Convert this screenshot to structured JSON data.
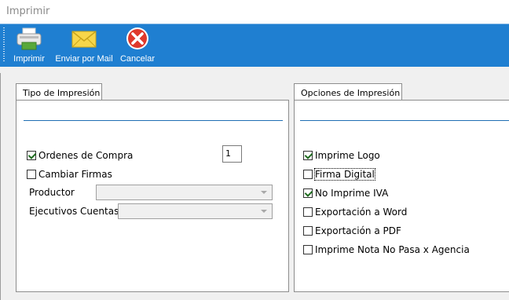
{
  "window": {
    "title": "Imprimir"
  },
  "toolbar": {
    "buttons": [
      {
        "label": "Imprimir",
        "icon": "printer-icon"
      },
      {
        "label": "Enviar por Mail",
        "icon": "envelope-icon"
      },
      {
        "label": "Cancelar",
        "icon": "cancel-icon"
      }
    ],
    "background": "#1f7fd1"
  },
  "tipo": {
    "tab_label": "Tipo de Impresión",
    "ordenes_label": "Ordenes de Compra",
    "ordenes_checked": true,
    "copies_value": "1",
    "cambiar_label": "Cambiar Firmas",
    "cambiar_checked": false,
    "productor_label": "Productor",
    "productor_value": "",
    "ejecutivos_label": "Ejecutivos Cuentas",
    "ejecutivos_value": ""
  },
  "opciones": {
    "tab_label": "Opciones de Impresión",
    "items": [
      {
        "label": "Imprime Logo",
        "checked": true
      },
      {
        "label": "Firma Digital",
        "checked": false
      },
      {
        "label": "No Imprime IVA",
        "checked": true
      },
      {
        "label": "Exportación a Word",
        "checked": false
      },
      {
        "label": "Exportación a PDF",
        "checked": false
      },
      {
        "label": "Imprime Nota No Pasa x Agencia",
        "checked": false
      }
    ]
  }
}
